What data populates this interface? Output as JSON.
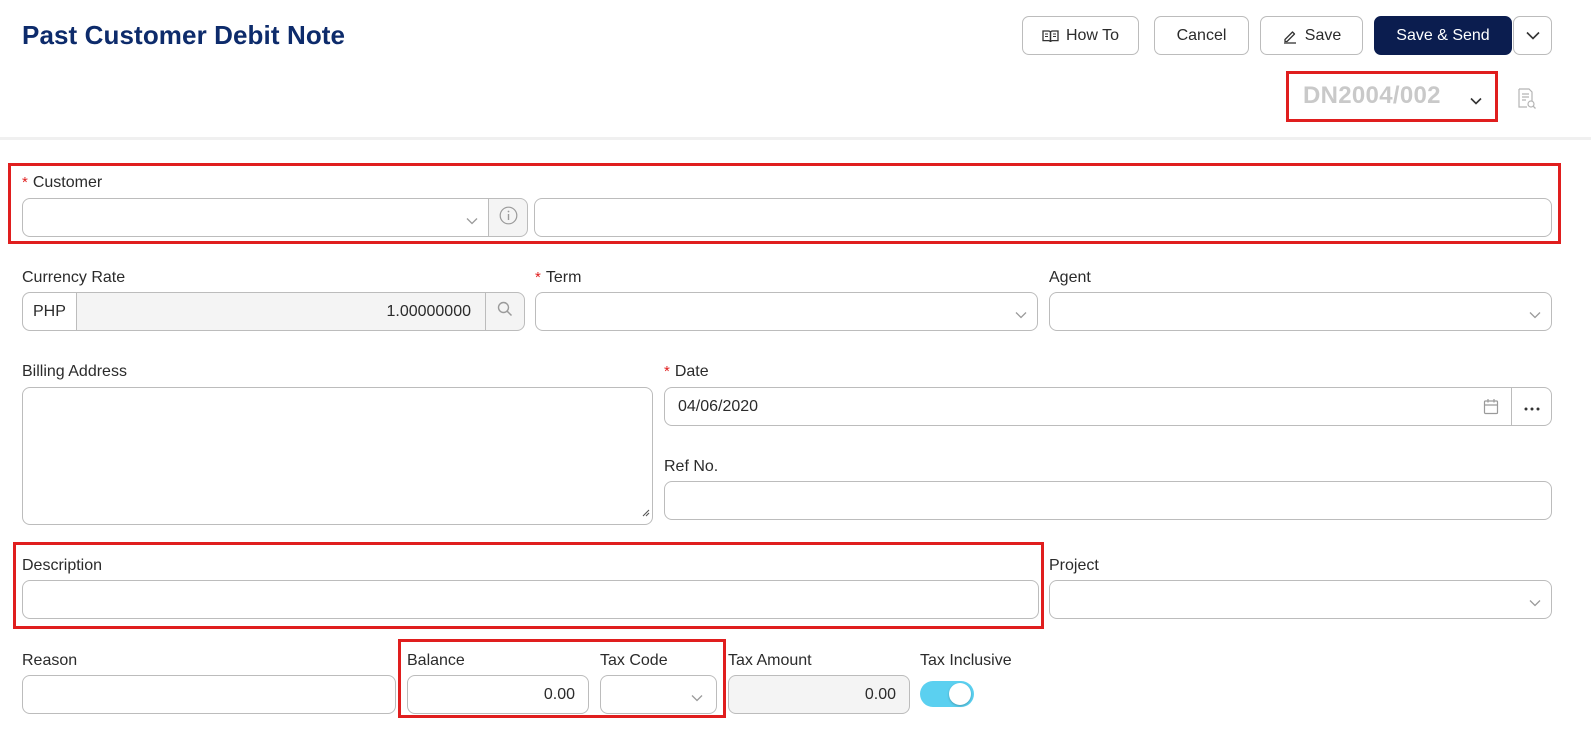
{
  "header": {
    "title": "Past Customer Debit Note",
    "buttons": {
      "how_to": "How To",
      "cancel": "Cancel",
      "save": "Save",
      "save_send": "Save & Send"
    },
    "doc_number": "DN2004/002"
  },
  "form": {
    "customer": {
      "label": "Customer",
      "required": true,
      "code_value": "",
      "name_value": ""
    },
    "currency_rate": {
      "label": "Currency Rate",
      "currency": "PHP",
      "rate": "1.00000000"
    },
    "term": {
      "label": "Term",
      "required": true,
      "value": ""
    },
    "agent": {
      "label": "Agent",
      "value": ""
    },
    "billing_address": {
      "label": "Billing Address",
      "value": ""
    },
    "date": {
      "label": "Date",
      "required": true,
      "value": "04/06/2020"
    },
    "ref_no": {
      "label": "Ref No.",
      "value": ""
    },
    "description": {
      "label": "Description",
      "value": ""
    },
    "project": {
      "label": "Project",
      "value": ""
    },
    "reason": {
      "label": "Reason",
      "value": ""
    },
    "balance": {
      "label": "Balance",
      "value": "0.00"
    },
    "tax_code": {
      "label": "Tax Code",
      "value": ""
    },
    "tax_amount": {
      "label": "Tax Amount",
      "value": "0.00"
    },
    "tax_inclusive": {
      "label": "Tax Inclusive",
      "on": true
    }
  },
  "colors": {
    "title": "#0d2b6b",
    "primary_button": "#0b1d4f",
    "highlight": "#e01e1e",
    "toggle_on": "#5bd0f0"
  }
}
